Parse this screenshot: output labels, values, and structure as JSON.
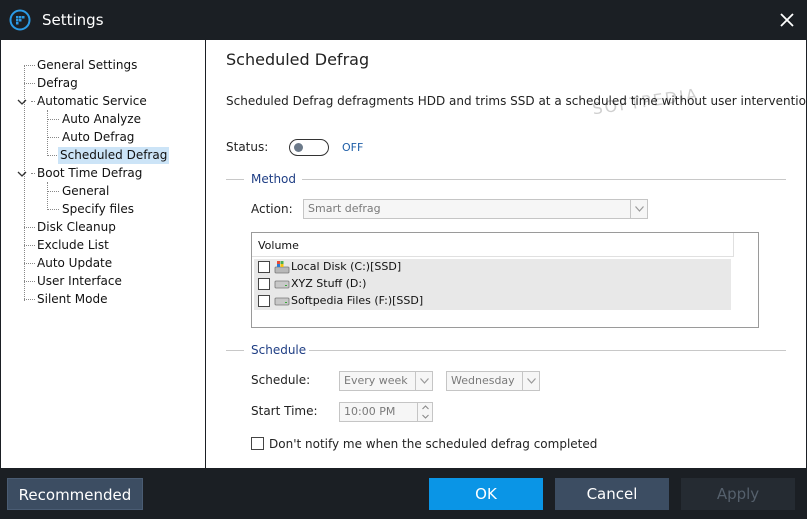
{
  "window": {
    "title": "Settings"
  },
  "sidebar": {
    "items": [
      {
        "label": "General Settings"
      },
      {
        "label": "Defrag"
      },
      {
        "label": "Automatic Service"
      },
      {
        "label": "Auto Analyze"
      },
      {
        "label": "Auto Defrag"
      },
      {
        "label": "Scheduled Defrag",
        "selected": true
      },
      {
        "label": "Boot Time Defrag"
      },
      {
        "label": "General"
      },
      {
        "label": "Specify files"
      },
      {
        "label": "Disk Cleanup"
      },
      {
        "label": "Exclude List"
      },
      {
        "label": "Auto Update"
      },
      {
        "label": "User Interface"
      },
      {
        "label": "Silent Mode"
      }
    ]
  },
  "main": {
    "title": "Scheduled Defrag",
    "description": "Scheduled Defrag defragments HDD and trims SSD at a scheduled time without user intervention.",
    "watermark": "SOFTPEDIA",
    "status": {
      "label": "Status:",
      "value": "OFF"
    },
    "method": {
      "section_title": "Method",
      "action_label": "Action:",
      "action_value": "Smart defrag",
      "volume_header": "Volume",
      "volumes": [
        {
          "label": "Local Disk (C:)[SSD]",
          "checked": false,
          "icon": "system-drive-icon"
        },
        {
          "label": "XYZ Stuff (D:)",
          "checked": false,
          "icon": "drive-icon"
        },
        {
          "label": "Softpedia Files (F:)[SSD]",
          "checked": false,
          "icon": "drive-icon"
        }
      ]
    },
    "schedule": {
      "section_title": "Schedule",
      "schedule_label": "Schedule:",
      "frequency_value": "Every week",
      "day_value": "Wednesday",
      "start_time_label": "Start Time:",
      "start_time_value": "10:00 PM",
      "notify_label": "Don't notify me when the scheduled defrag completed",
      "notify_checked": false
    }
  },
  "footer": {
    "recommended_label": "Recommended",
    "ok_label": "OK",
    "cancel_label": "Cancel",
    "apply_label": "Apply"
  },
  "colors": {
    "titlebar": "#1b1f24",
    "accent": "#0a95e6",
    "section_title": "#1f3e84",
    "selected_item": "#cce4f7"
  }
}
